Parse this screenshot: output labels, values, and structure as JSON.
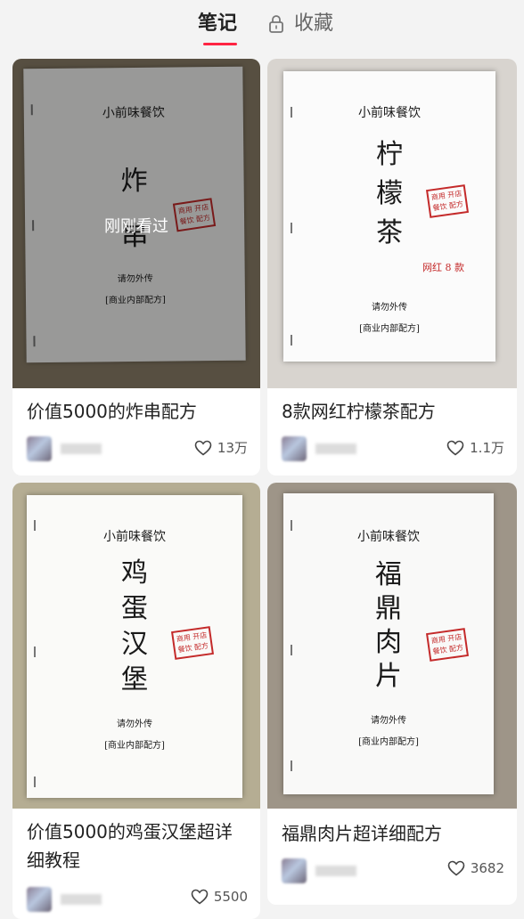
{
  "tabs": [
    {
      "label": "笔记",
      "active": true
    },
    {
      "label": "收藏",
      "active": false,
      "icon": "lock-icon"
    }
  ],
  "accent_color": "#ff2442",
  "seen_label": "刚刚看过",
  "cards": [
    {
      "title": "价值5000的炸串配方",
      "likes": "13万",
      "seen": true,
      "paper": {
        "header": "小前味餐饮",
        "title": [
          "炸",
          "串"
        ],
        "notice": "请勿外传",
        "footer": "[商业内部配方]",
        "stamp": "商用 开店\n餐饮 配方",
        "note": ""
      }
    },
    {
      "title": "8款网红柠檬茶配方",
      "likes": "1.1万",
      "seen": false,
      "paper": {
        "header": "小前味餐饮",
        "title": [
          "柠",
          "檬",
          "茶"
        ],
        "notice": "请勿外传",
        "footer": "[商业内部配方]",
        "stamp": "商用 开店\n餐饮 配方",
        "note": "网红 8 款"
      }
    },
    {
      "title": "价值5000的鸡蛋汉堡超详细教程",
      "likes": "5500",
      "seen": false,
      "paper": {
        "header": "小前味餐饮",
        "title": [
          "鸡",
          "蛋",
          "汉",
          "堡"
        ],
        "notice": "请勿外传",
        "footer": "[商业内部配方]",
        "stamp": "商用 开店\n餐饮 配方",
        "note": ""
      }
    },
    {
      "title": "福鼎肉片超详细配方",
      "likes": "3682",
      "seen": false,
      "paper": {
        "header": "小前味餐饮",
        "title": [
          "福",
          "鼎",
          "肉",
          "片"
        ],
        "notice": "请勿外传",
        "footer": "[商业内部配方]",
        "stamp": "商用 开店\n餐饮 配方",
        "note": ""
      }
    }
  ]
}
